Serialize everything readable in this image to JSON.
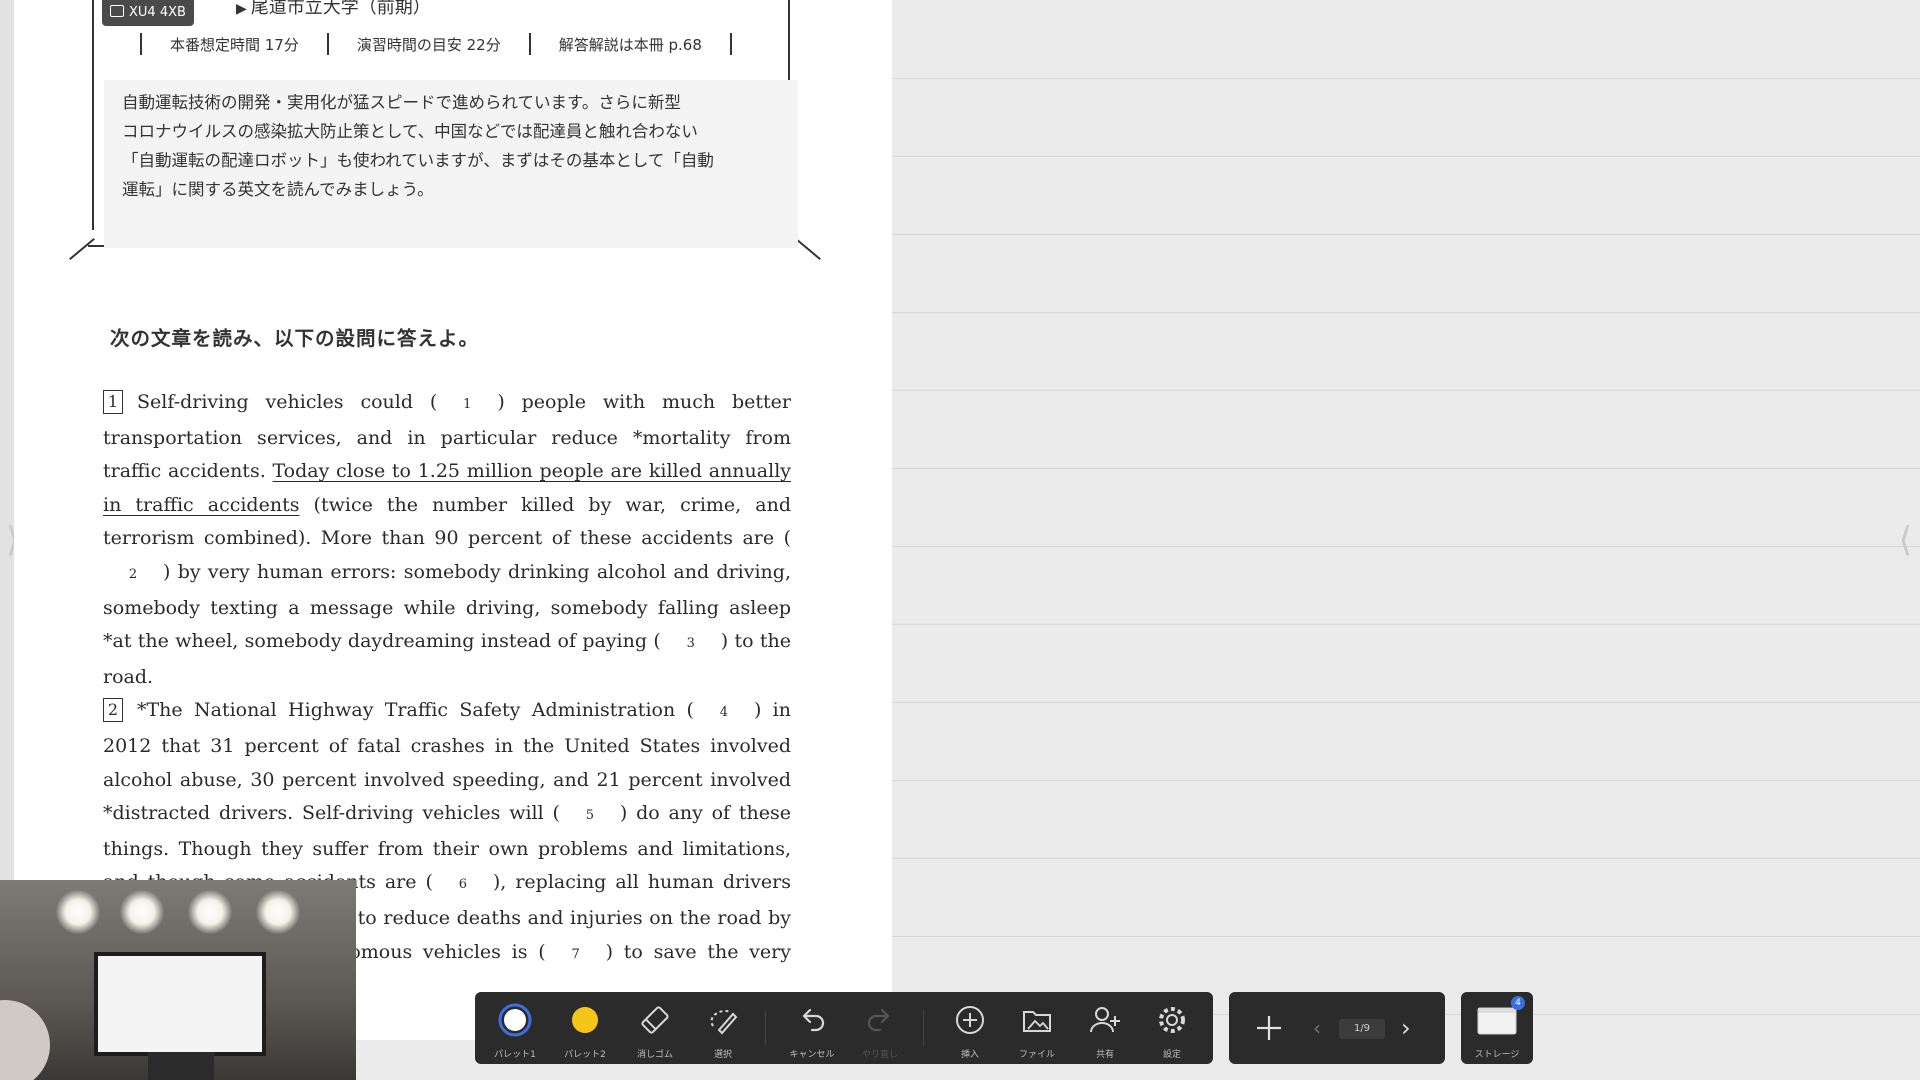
{
  "header": {
    "code": "XU4 4XB",
    "university": "尾道市立大学（前期）",
    "times": [
      "本番想定時間 17分",
      "演習時間の目安 22分",
      "解答解説は本冊 p.68"
    ]
  },
  "intro": [
    "自動運転技術の開発・実用化が猛スピードで進められています。さらに新型",
    "コロナウイルスの感染拡大防止策として、中国などでは配達員と触れ合わない",
    "「自動運転の配達ロボット」も使われていますが、まずはその基本として「自動",
    "運転」に関する英文を読んでみましょう。"
  ],
  "instruction": "次の文章を読み、以下の設問に答えよ。",
  "passage": {
    "p1": {
      "num": "1",
      "t1": "Self-driving vehicles could (",
      "b1": "1",
      "t2": ") people with much better transportation services, and in particular reduce *mortality from traffic accidents. ",
      "underlined": "Today close to 1.25 million people are killed annually in traffic accidents",
      "t3": " (twice the number killed by war, crime, and terrorism combined). More than 90 percent of these accidents are (",
      "b2": "2",
      "t4": ") by very human errors: somebody drinking alcohol and driving, somebody texting a message while driving, somebody falling asleep *at the wheel, somebody daydreaming instead of paying (",
      "b3": "3",
      "t5": ") to the road."
    },
    "p2": {
      "num": "2",
      "t1": "*The National Highway Traffic Safety Administration (",
      "b4": "4",
      "t2": ") in 2012 that 31 percent of fatal crashes in the United States involved alcohol abuse, 30 percent involved speeding, and 21 percent involved *distracted drivers. Self-driving vehicles will (",
      "b5": "5",
      "t3": ") do any of these things. Though they suffer from their own problems and limitations, and though some accidents are (",
      "b6": "6",
      "t4": "), replacing all human drivers by computers is expected to reduce deaths and injuries on the road by about 90 percent. autonomous vehicles is (",
      "b7": "7",
      "t5": ") to save the very year."
    }
  },
  "toolbar": {
    "palette1": "パレット1",
    "palette2": "パレット2",
    "eraser": "消しゴム",
    "select": "選択",
    "cancel": "キャンセル",
    "redo": "やり直し",
    "insert": "挿入",
    "file": "ファイル",
    "share": "共有",
    "settings": "設定",
    "page": "1/9",
    "storage": "ストレージ",
    "storage_badge": "4"
  },
  "colors": {
    "palette1": "#ffffff",
    "palette2": "#f5c518",
    "toolbar_bg": "#2b2b2b",
    "badge": "#3b6fe0"
  }
}
